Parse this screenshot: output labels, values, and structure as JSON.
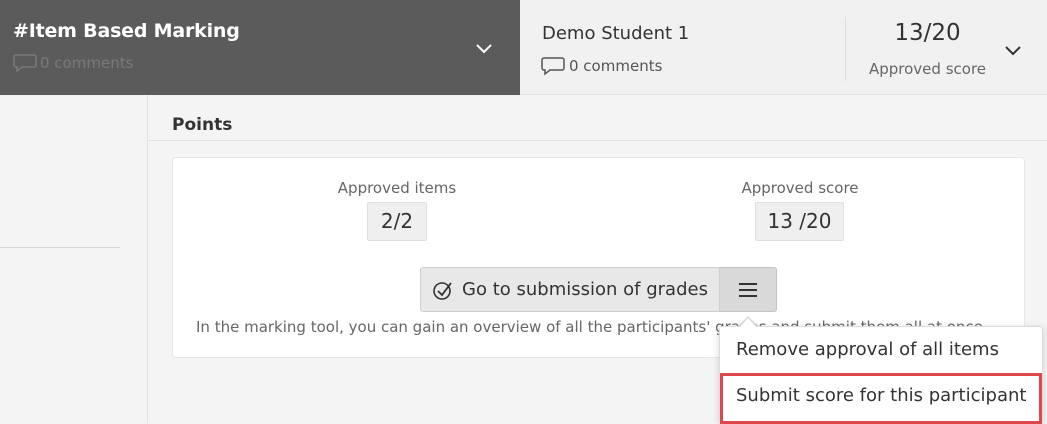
{
  "item": {
    "title": "#Item Based Marking",
    "comments": "0 comments"
  },
  "student": {
    "name": "Demo Student 1",
    "comments": "0 comments",
    "score": "13/20",
    "score_label": "Approved score"
  },
  "section": {
    "title": "Points"
  },
  "card": {
    "approved_items_label": "Approved items",
    "approved_items_value": "2/2",
    "approved_score_label": "Approved score",
    "approved_score_value": "13 /20",
    "submit_button_label": "Go to submission of grades",
    "hint": "In the marking tool, you can gain an overview of all the participants' grades and submit them all at once."
  },
  "menu": {
    "items": [
      {
        "label": "Remove approval of all items"
      },
      {
        "label": "Submit score for this participant"
      }
    ]
  },
  "colors": {
    "header_dark": "#5b5b5b",
    "highlight": "#e0474c"
  },
  "icons": [
    "comment-icon",
    "chevron-down-icon",
    "check-circle-icon",
    "menu-icon"
  ]
}
